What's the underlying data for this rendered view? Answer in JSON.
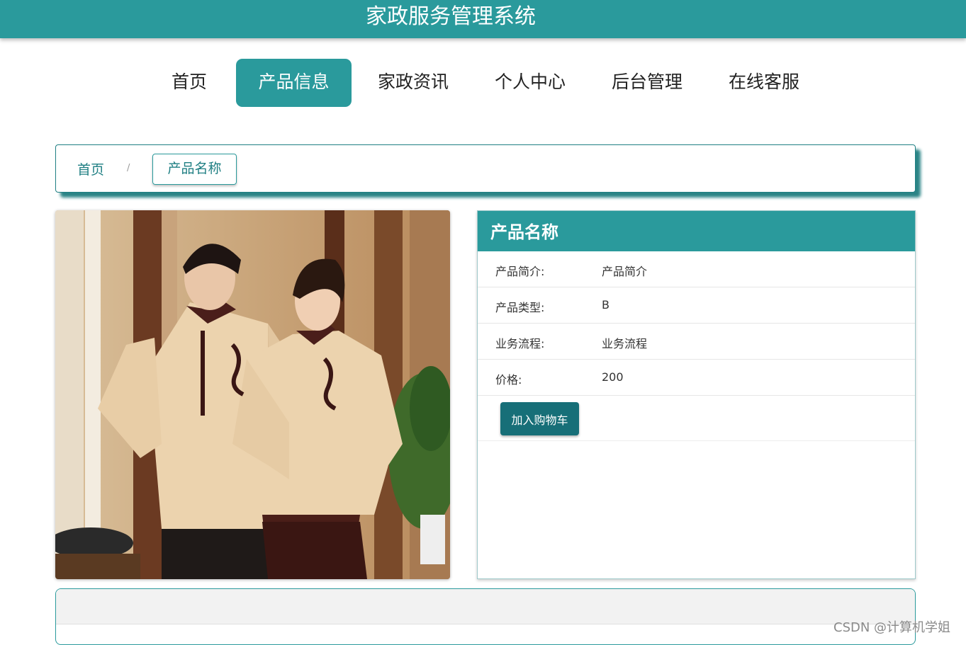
{
  "header": {
    "title": "家政服务管理系统"
  },
  "nav": {
    "items": [
      {
        "label": "首页"
      },
      {
        "label": "产品信息",
        "active": true
      },
      {
        "label": "家政资讯"
      },
      {
        "label": "个人中心"
      },
      {
        "label": "后台管理"
      },
      {
        "label": "在线客服"
      }
    ]
  },
  "breadcrumb": {
    "home": "首页",
    "separator": "/",
    "current": "产品名称"
  },
  "product": {
    "image_alt": "product-photo-uniform-couple",
    "title": "产品名称",
    "fields": [
      {
        "label": "产品简介:",
        "value": "产品简介"
      },
      {
        "label": "产品类型:",
        "value": "B"
      },
      {
        "label": "业务流程:",
        "value": "业务流程"
      },
      {
        "label": "价格:",
        "value": "200"
      }
    ],
    "cart_button": "加入购物车"
  },
  "watermark": "CSDN @计算机学姐",
  "colors": {
    "primary": "#2a9a9c",
    "button": "#176f78",
    "text": "#333333"
  }
}
